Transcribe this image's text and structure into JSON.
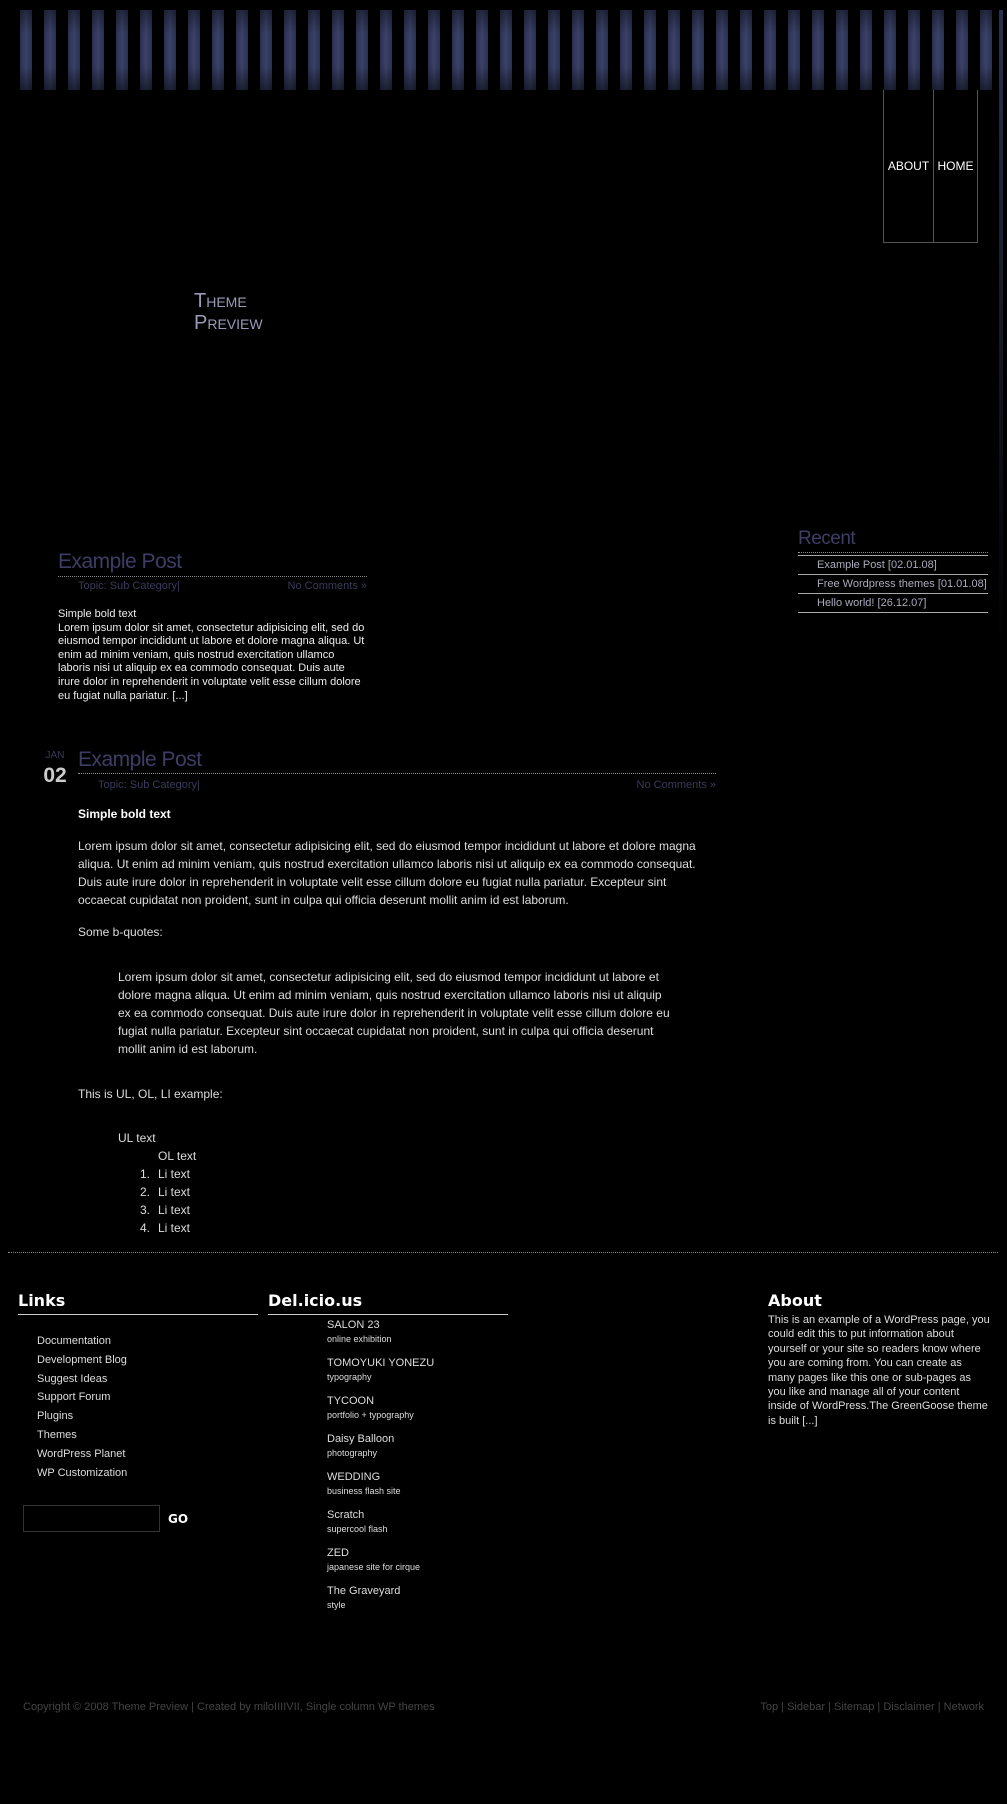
{
  "header": {
    "title_line1": "Theme",
    "title_line2": "Preview",
    "nav": [
      {
        "label": "ABOUT"
      },
      {
        "label": "HOME"
      }
    ]
  },
  "recent": {
    "title": "Recent",
    "items": [
      "Example Post [02.01.08]",
      "Free Wordpress themes [01.01.08]",
      "Hello world! [26.12.07]"
    ]
  },
  "post1": {
    "title": "Example Post",
    "topic": "Topic: Sub Category|",
    "comments": "No Comments »",
    "bold": "Simple bold text",
    "body": "Lorem ipsum dolor sit amet, consectetur adipisicing elit, sed do eiusmod tempor incididunt ut labore et dolore magna aliqua. Ut enim ad minim veniam, quis nostrud exercitation ullamco laboris nisi ut aliquip ex ea commodo consequat. Duis aute irure dolor in reprehenderit in voluptate velit esse cillum dolore eu fugiat nulla pariatur. [...]"
  },
  "post2": {
    "month": "JAN",
    "day": "02",
    "title": "Example Post",
    "topic": "Topic: Sub Category|",
    "comments": "No Comments »",
    "bold": "Simple bold text",
    "para": "Lorem ipsum dolor sit amet, consectetur adipisicing elit, sed do eiusmod tempor incididunt ut labore et dolore magna aliqua. Ut enim ad minim veniam, quis nostrud exercitation ullamco laboris nisi ut aliquip ex ea commodo consequat. Duis aute irure dolor in reprehenderit in voluptate velit esse cillum dolore eu fugiat nulla pariatur. Excepteur sint occaecat cupidatat non proident, sunt in culpa qui officia deserunt mollit anim id est laborum.",
    "bquote_intro": "Some b-quotes:",
    "bquote": "Lorem ipsum dolor sit amet, consectetur adipisicing elit, sed do eiusmod tempor incididunt ut labore et dolore magna aliqua. Ut enim ad minim veniam, quis nostrud exercitation ullamco laboris nisi ut aliquip ex ea commodo consequat. Duis aute irure dolor in reprehenderit in voluptate velit esse cillum dolore eu fugiat nulla pariatur. Excepteur sint occaecat cupidatat non proident, sunt in culpa qui officia deserunt mollit anim id est laborum.",
    "list_intro": "This is UL, OL, LI example:",
    "ul_text": "UL text",
    "ol_text": "OL text",
    "li": [
      "Li text",
      "Li text",
      "Li text",
      "Li text"
    ]
  },
  "footer": {
    "links": {
      "title": "Links",
      "items": [
        "Documentation",
        "Development Blog",
        "Suggest Ideas",
        "Support Forum",
        "Plugins",
        "Themes",
        "WordPress Planet",
        "WP Customization"
      ]
    },
    "search": {
      "value": "",
      "go": "GO"
    },
    "delicious": {
      "title": "Del.icio.us",
      "items": [
        {
          "t": "SALON 23",
          "s": "online exhibition"
        },
        {
          "t": "TOMOYUKI YONEZU",
          "s": "typography"
        },
        {
          "t": "TYCOON",
          "s": "portfolio + typography"
        },
        {
          "t": "Daisy Balloon",
          "s": "photography"
        },
        {
          "t": "WEDDING",
          "s": "business flash site"
        },
        {
          "t": "Scratch",
          "s": "supercool flash"
        },
        {
          "t": "ZED",
          "s": "japanese site for cirque"
        },
        {
          "t": "The Graveyard",
          "s": "style"
        }
      ]
    },
    "about": {
      "title": "About",
      "text": "This is an example of a WordPress page, you could edit this to put information about yourself or your site so readers know where you are coming from. You can create as many pages like this one or sub-pages as you like and manage all of your content inside of WordPress.The GreenGoose theme is built [...]"
    },
    "copyright": "Copyright © 2008 Theme Preview | Created by miloIIIIVII, Single column WP themes",
    "bottom_links": [
      "Top",
      "Sidebar",
      "Sitemap",
      "Disclaimer",
      "Network"
    ]
  },
  "colors": {
    "title": "#9a9ab8",
    "post_title": "#3d3d66",
    "stripe": "#3a4268"
  }
}
